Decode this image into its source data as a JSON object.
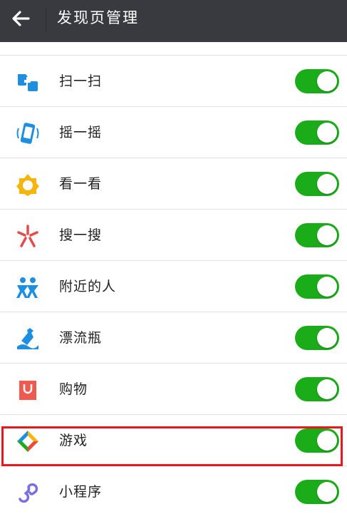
{
  "header": {
    "title": "发现页管理"
  },
  "colors": {
    "header_bg": "#393a3f",
    "toggle_on": "#1aad19",
    "highlight": "#e8161d"
  },
  "items": [
    {
      "label": "扫一扫",
      "icon": "scan-icon",
      "enabled": true
    },
    {
      "label": "摇一摇",
      "icon": "shake-icon",
      "enabled": true
    },
    {
      "label": "看一看",
      "icon": "top-stories-icon",
      "enabled": true
    },
    {
      "label": "搜一搜",
      "icon": "search-icon",
      "enabled": true
    },
    {
      "label": "附近的人",
      "icon": "people-nearby-icon",
      "enabled": true
    },
    {
      "label": "漂流瓶",
      "icon": "drift-bottle-icon",
      "enabled": true
    },
    {
      "label": "购物",
      "icon": "shopping-icon",
      "enabled": true
    },
    {
      "label": "游戏",
      "icon": "games-icon",
      "enabled": true
    },
    {
      "label": "小程序",
      "icon": "mini-programs-icon",
      "enabled": true
    }
  ]
}
